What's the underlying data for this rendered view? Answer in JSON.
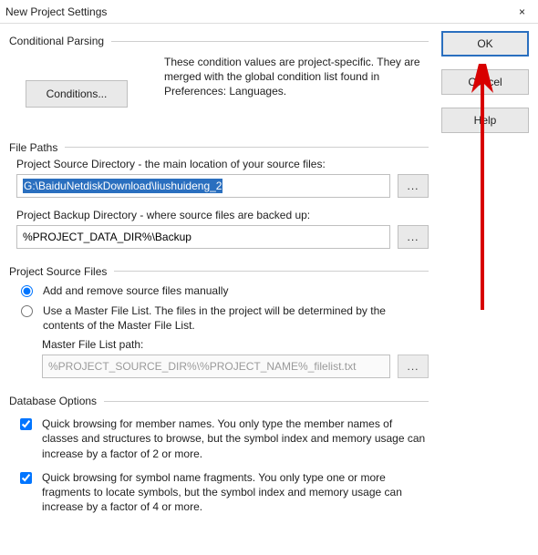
{
  "window": {
    "title": "New Project Settings",
    "close": "×"
  },
  "buttons": {
    "ok": "OK",
    "cancel": "Cancel",
    "help": "Help",
    "conditions": "Conditions...",
    "browse": "..."
  },
  "conditional": {
    "title": "Conditional Parsing",
    "desc": "These condition values are project-specific.  They are merged with the global condition list found in Preferences: Languages."
  },
  "filepaths": {
    "title": "File Paths",
    "src_label": "Project Source Directory - the main location of your source files:",
    "src_value": "G:\\BaiduNetdiskDownload\\liushuideng_2",
    "bak_label": "Project Backup Directory - where source files are backed up:",
    "bak_value": "%PROJECT_DATA_DIR%\\Backup"
  },
  "psf": {
    "title": "Project Source Files",
    "opt_manual": "Add and remove source files manually",
    "opt_master": "Use a Master File List. The files in the project will be determined by the contents of the Master File List.",
    "mfl_label": "Master File List path:",
    "mfl_value": "%PROJECT_SOURCE_DIR%\\%PROJECT_NAME%_filelist.txt"
  },
  "db": {
    "title": "Database Options",
    "chk1": "Quick browsing for member names.  You only type the member names of classes and structures to browse, but the symbol index and memory usage can increase by a factor of 2 or more.",
    "chk2": "Quick browsing for symbol name fragments.  You only type one or more fragments to locate symbols, but the symbol index and memory usage can increase by a factor of 4 or more."
  }
}
